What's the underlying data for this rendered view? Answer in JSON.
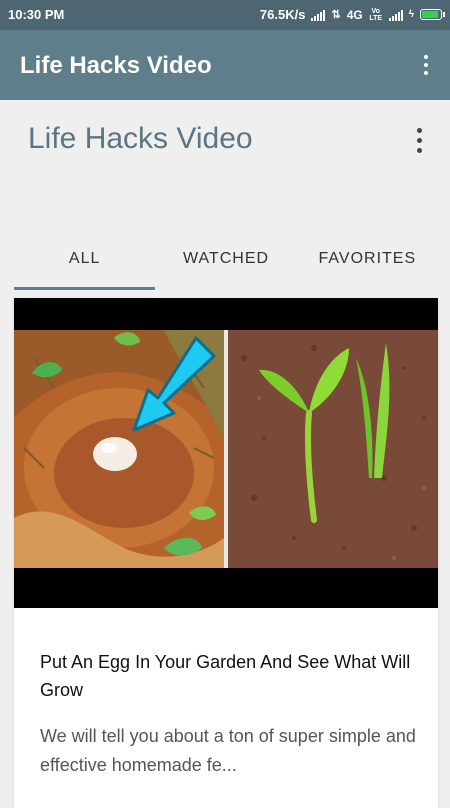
{
  "status_bar": {
    "time": "10:30 PM",
    "speed": "76.5K/s",
    "network": "4G",
    "volte": "Vo LTE",
    "battery_level": 0.9
  },
  "app_bar": {
    "title": "Life Hacks Video"
  },
  "header": {
    "title": "Life Hacks Video"
  },
  "tabs": [
    {
      "label": "ALL",
      "active": true
    },
    {
      "label": "WATCHED",
      "active": false
    },
    {
      "label": "FAVORITES",
      "active": false
    }
  ],
  "video_card": {
    "title": "Put An Egg In Your Garden And See What Will Grow",
    "description": "We will tell you about a ton of super simple and effective homemade fe..."
  },
  "colors": {
    "status_bar": "#4e6672",
    "app_bar": "#5f7e8c",
    "header_title": "#5b7582",
    "arrow": "#1ec9f2"
  },
  "icons": [
    "signal-icon",
    "data-arrows-icon",
    "battery-icon",
    "overflow-menu-icon"
  ]
}
